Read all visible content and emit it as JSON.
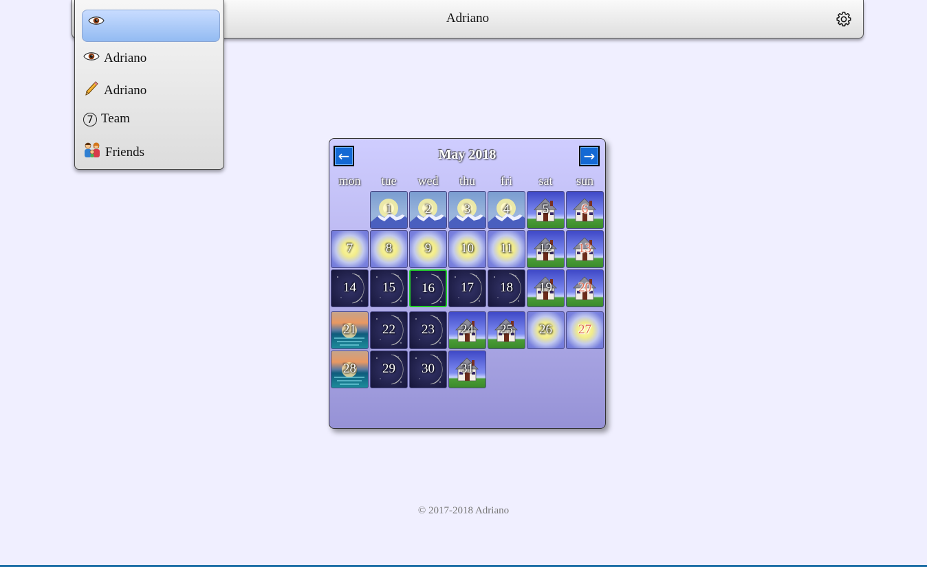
{
  "header": {
    "title": "Adriano"
  },
  "menu": {
    "selected_label": "",
    "items": [
      {
        "icon": "eye-icon",
        "label": "Adriano"
      },
      {
        "icon": "pencil-icon",
        "label": "Adriano"
      },
      {
        "icon": "circled-7-icon",
        "badge": "7",
        "label": "Team"
      },
      {
        "icon": "family-icon",
        "label": "Friends"
      }
    ]
  },
  "calendar": {
    "title": "May 2018",
    "prev_label": "←",
    "next_label": "→",
    "weekdays": [
      "mon",
      "tue",
      "wed",
      "thu",
      "fri",
      "sat",
      "sun"
    ],
    "days": [
      {
        "day": "1",
        "weather": "sun-mountain"
      },
      {
        "day": "2",
        "weather": "sun-mountain"
      },
      {
        "day": "3",
        "weather": "sun-mountain"
      },
      {
        "day": "4",
        "weather": "sun-mountain"
      },
      {
        "day": "5",
        "weather": "house"
      },
      {
        "day": "6",
        "weather": "house",
        "holiday": true
      },
      {
        "day": "7",
        "weather": "sun"
      },
      {
        "day": "8",
        "weather": "sun"
      },
      {
        "day": "9",
        "weather": "sun"
      },
      {
        "day": "10",
        "weather": "sun"
      },
      {
        "day": "11",
        "weather": "sun"
      },
      {
        "day": "12",
        "weather": "house"
      },
      {
        "day": "13",
        "weather": "house",
        "holiday": true
      },
      {
        "day": "14",
        "weather": "moon"
      },
      {
        "day": "15",
        "weather": "moon"
      },
      {
        "day": "16",
        "weather": "moon",
        "today": true
      },
      {
        "day": "17",
        "weather": "moon"
      },
      {
        "day": "18",
        "weather": "moon"
      },
      {
        "day": "19",
        "weather": "house"
      },
      {
        "day": "20",
        "weather": "house",
        "holiday": true
      },
      {
        "day": "21",
        "weather": "sunset"
      },
      {
        "day": "22",
        "weather": "moon"
      },
      {
        "day": "23",
        "weather": "moon"
      },
      {
        "day": "24",
        "weather": "house"
      },
      {
        "day": "25",
        "weather": "house"
      },
      {
        "day": "26",
        "weather": "sun"
      },
      {
        "day": "27",
        "weather": "sun",
        "holiday": true
      },
      {
        "day": "28",
        "weather": "sunset"
      },
      {
        "day": "29",
        "weather": "moon"
      },
      {
        "day": "30",
        "weather": "moon"
      },
      {
        "day": "31",
        "weather": "house"
      }
    ]
  },
  "footer": {
    "text": "© 2017-2018 Adriano"
  },
  "colors": {
    "background": "#f0efff",
    "accent_blue": "#1469d4",
    "today_border": "#22d02a",
    "holiday_text": "#e06a52"
  }
}
